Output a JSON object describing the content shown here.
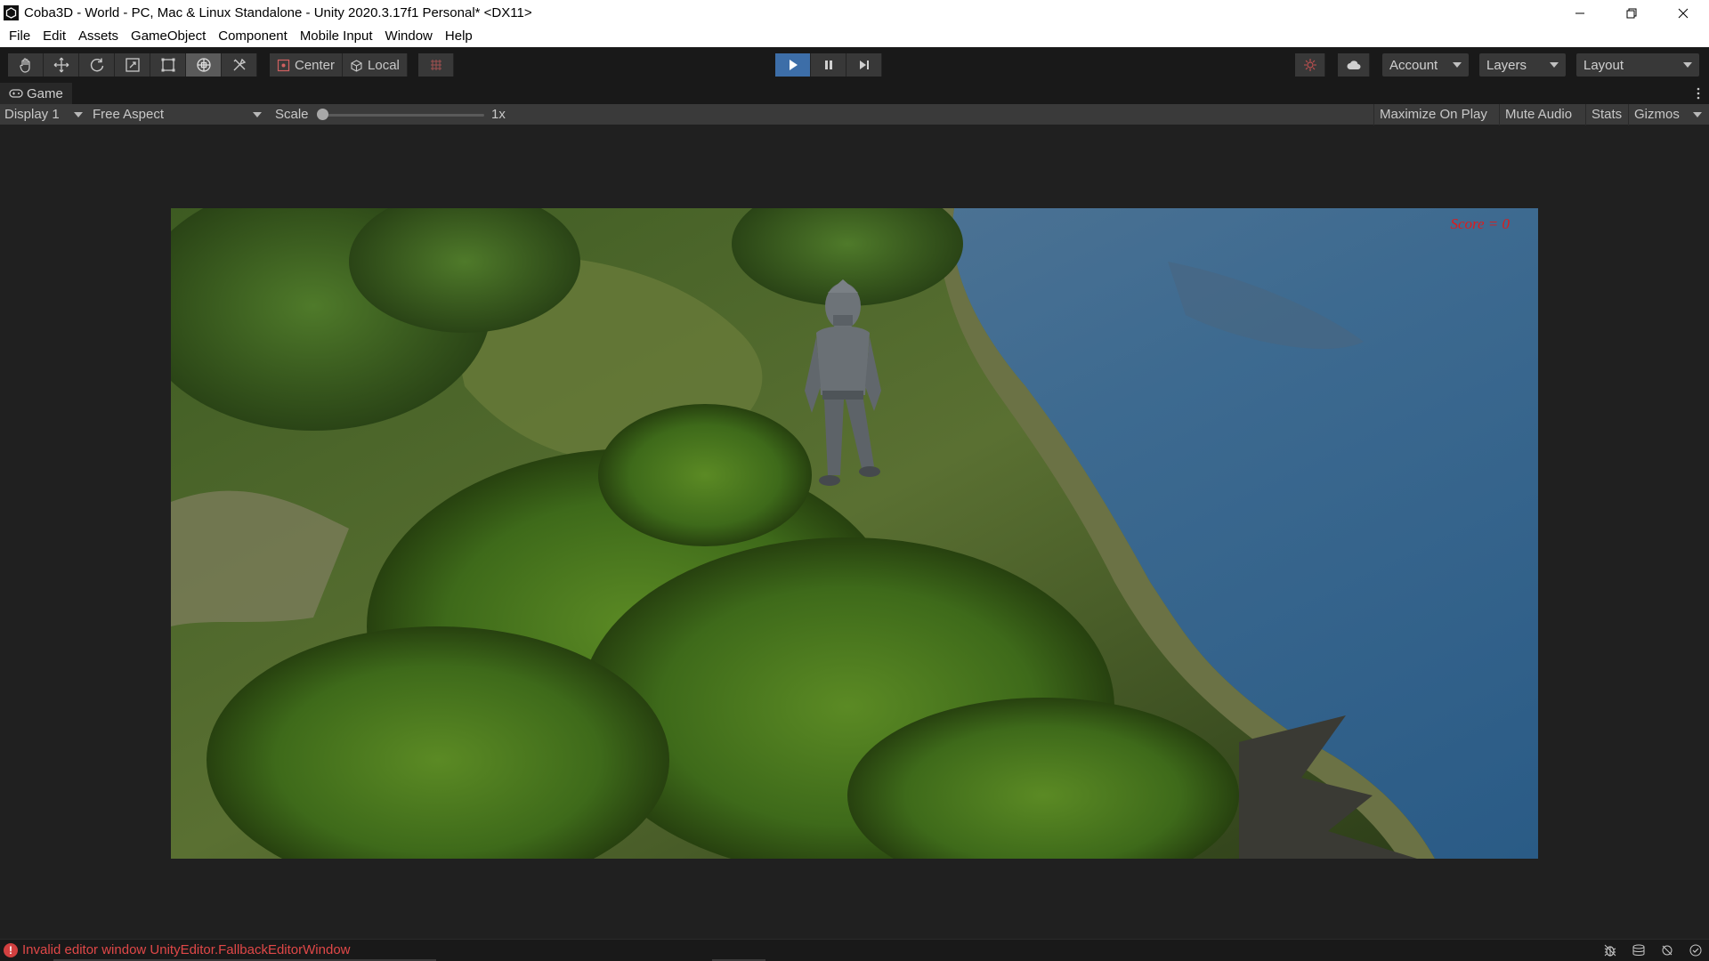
{
  "window": {
    "title": "Coba3D - World - PC, Mac & Linux Standalone - Unity 2020.3.17f1 Personal* <DX11>"
  },
  "menu": [
    "File",
    "Edit",
    "Assets",
    "GameObject",
    "Component",
    "Mobile Input",
    "Window",
    "Help"
  ],
  "toolbar": {
    "tools": [
      "hand-tool-icon",
      "move-tool-icon",
      "rotate-tool-icon",
      "scale-tool-icon",
      "rect-tool-icon",
      "transform-tool-icon",
      "custom-tool-icon"
    ],
    "pivot_label": "Center",
    "space_label": "Local",
    "account_label": "Account",
    "layers_label": "Layers",
    "layout_label": "Layout",
    "play_active": true
  },
  "game_tab": {
    "label": "Game"
  },
  "game_toolbar": {
    "display": "Display 1",
    "aspect": "Free Aspect",
    "scale_label": "Scale",
    "scale_value": "1x",
    "scale_fraction": 0,
    "maximize_on_play": "Maximize On Play",
    "mute_audio": "Mute Audio",
    "stats": "Stats",
    "gizmos": "Gizmos"
  },
  "game_view": {
    "score_text": "Score = 0",
    "score_color": "#e01a1a"
  },
  "status": {
    "message": "Invalid editor window UnityEditor.FallbackEditorWindow",
    "message_color": "#e04848"
  },
  "colors": {
    "play_active": "#3d6ea8",
    "editor_bg": "#202020",
    "panel": "#3a3a3a"
  }
}
